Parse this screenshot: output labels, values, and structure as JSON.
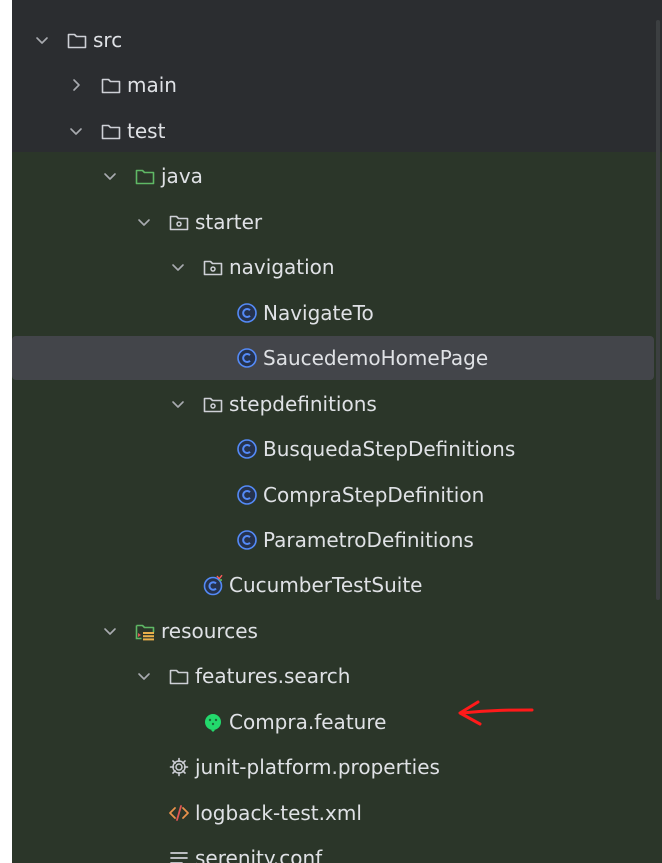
{
  "tree": [
    {
      "label": "src",
      "expanded": true,
      "icon": "folder-icon",
      "depth": 0
    },
    {
      "label": "main",
      "expanded": false,
      "icon": "folder-icon",
      "depth": 1
    },
    {
      "label": "test",
      "expanded": true,
      "icon": "folder-icon",
      "depth": 1
    },
    {
      "label": "java",
      "expanded": true,
      "icon": "test-source-folder-icon",
      "depth": 2
    },
    {
      "label": "starter",
      "expanded": true,
      "icon": "package-icon",
      "depth": 3
    },
    {
      "label": "navigation",
      "expanded": true,
      "icon": "package-icon",
      "depth": 4
    },
    {
      "label": "NavigateTo",
      "icon": "java-class-icon",
      "depth": 5
    },
    {
      "label": "SaucedemoHomePage",
      "icon": "java-class-icon",
      "depth": 5,
      "selected": true
    },
    {
      "label": "stepdefinitions",
      "expanded": true,
      "icon": "package-icon",
      "depth": 4
    },
    {
      "label": "BusquedaStepDefinitions",
      "icon": "java-class-icon",
      "depth": 5
    },
    {
      "label": "CompraStepDefinition",
      "icon": "java-class-icon",
      "depth": 5
    },
    {
      "label": "ParametroDefinitions",
      "icon": "java-class-icon",
      "depth": 5
    },
    {
      "label": "CucumberTestSuite",
      "icon": "junit-test-class-icon",
      "depth": 4
    },
    {
      "label": "resources",
      "expanded": true,
      "icon": "test-resources-folder-icon",
      "depth": 2
    },
    {
      "label": "features.search",
      "expanded": true,
      "icon": "folder-icon",
      "depth": 3
    },
    {
      "label": "Compra.feature",
      "icon": "cucumber-icon",
      "depth": 4
    },
    {
      "label": "junit-platform.properties",
      "icon": "gear-icon",
      "depth": 3
    },
    {
      "label": "logback-test.xml",
      "icon": "xml-icon",
      "depth": 3
    },
    {
      "label": "serenity.conf",
      "icon": "text-lines-icon",
      "depth": 3
    }
  ],
  "colors": {
    "background": "#2b2d30",
    "test_background": "#2b3629",
    "selection": "#43454a",
    "text": "#dfe1e5",
    "class_icon": "#548af7",
    "annotation_arrow": "#ff1a1a"
  }
}
